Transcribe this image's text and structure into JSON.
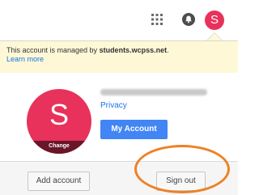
{
  "colors": {
    "accent_avatar": "#e8315b",
    "my_account_button": "#4285f4",
    "highlight_ring": "#ee8124",
    "banner_background": "#fff8d7",
    "link": "#1a73e8"
  },
  "topbar": {
    "apps_icon": "apps-grid-icon",
    "notifications_icon": "notifications-icon",
    "avatar_letter": "S"
  },
  "managed_banner": {
    "prefix": "This account is managed by ",
    "domain": "students.wcpss.net",
    "suffix": ".",
    "learn_more": "Learn more"
  },
  "account": {
    "avatar_letter": "S",
    "change_label": "Change",
    "privacy": "Privacy",
    "my_account": "My Account"
  },
  "footer": {
    "add_account": "Add account",
    "sign_out": "Sign out"
  }
}
